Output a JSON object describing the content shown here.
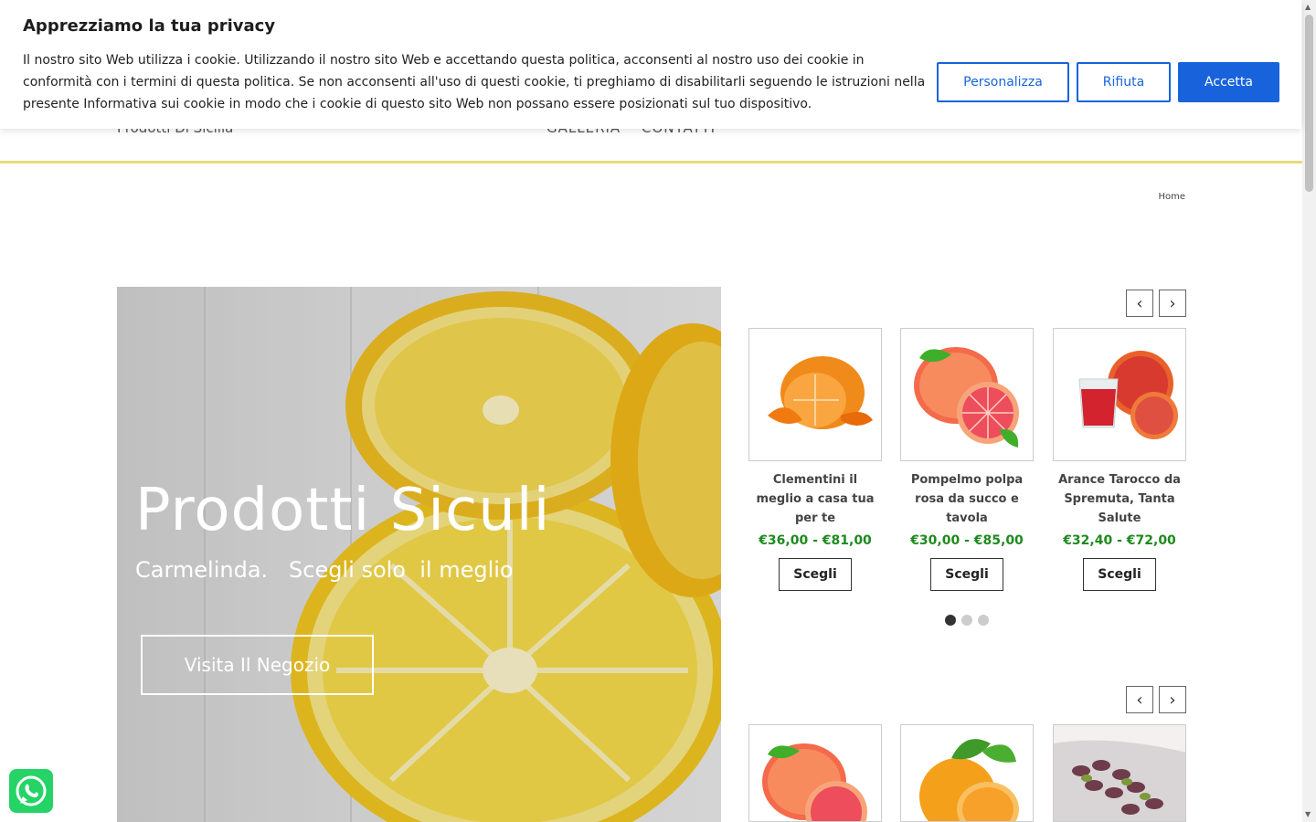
{
  "cookie": {
    "title": "Apprezziamo la tua privacy",
    "text": "Il nostro sito Web utilizza i cookie. Utilizzando il nostro sito Web e accettando questa politica, acconsenti al nostro uso dei cookie in conformità con i termini di questa politica. Se non acconsenti all'uso di questi cookie, ti preghiamo di disabilitarli seguendo le istruzioni nella presente Informativa sui cookie in modo che i cookie di questo sito Web non possano essere posizionati sul tuo dispositivo.",
    "customize_label": "Personalizza",
    "reject_label": "Rifiuta",
    "accept_label": "Accetta",
    "accent_color": "#1863dc"
  },
  "header": {
    "tagline": "Prodotti Di Sicilia",
    "nav": [
      "GALLERIA",
      "CONTATTI"
    ],
    "border_color": "#e6dc7a"
  },
  "breadcrumb": {
    "home": "Home"
  },
  "hero": {
    "title": "Prodotti Siculi",
    "subtitle": "Carmelinda.   Scegli solo  il meglio",
    "button_label": "Visita Il Negozio"
  },
  "carousel1": {
    "products": [
      {
        "name": "Clementini il meglio a casa tua per te",
        "price": "€36,00 - €81,00",
        "button": "Scegli",
        "image": "clementine"
      },
      {
        "name": "Pompelmo polpa rosa da succo e tavola",
        "price": "€30,00 - €85,00",
        "button": "Scegli",
        "image": "grapefruit"
      },
      {
        "name": "Arance Tarocco da Spremuta, Tanta Salute",
        "price": "€32,40 - €72,00",
        "button": "Scegli",
        "image": "blood-orange-juice"
      }
    ],
    "pages": 3,
    "active_page": 1
  },
  "carousel2": {
    "products": [
      {
        "image": "grapefruit"
      },
      {
        "image": "orange"
      },
      {
        "image": "pistachio"
      }
    ]
  },
  "price_color": "#1e8a1e"
}
